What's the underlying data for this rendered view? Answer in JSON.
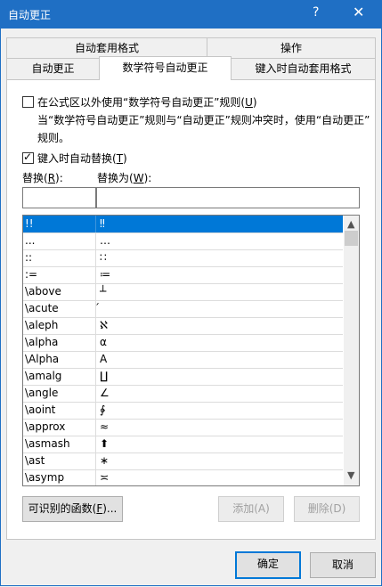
{
  "window": {
    "title": "自动更正",
    "help_glyph": "?",
    "close_glyph": "✕"
  },
  "tabs": {
    "row1": [
      "自动套用格式",
      "操作"
    ],
    "row2": [
      "自动更正",
      "数学符号自动更正",
      "键入时自动套用格式"
    ],
    "active": "数学符号自动更正"
  },
  "option_formula": {
    "checked": false,
    "label_pre": "在公式区以外使用“数学符号自动更正”规则(",
    "label_key": "U",
    "label_post": ")"
  },
  "note": {
    "line1": "当“数学符号自动更正”规则与“自动更正”规则冲突时，使用“自动更正”",
    "line2": "规则。"
  },
  "option_replace": {
    "checked": true,
    "check_glyph": "✓",
    "label_pre": "键入时自动替换(",
    "label_key": "T",
    "label_post": ")"
  },
  "fields": {
    "replace_label_pre": "替换(",
    "replace_label_key": "R",
    "replace_label_post": "):",
    "with_label_pre": "替换为(",
    "with_label_key": "W",
    "with_label_post": "):",
    "replace_value": "",
    "with_value": ""
  },
  "table": {
    "rows": [
      {
        "from": "!!",
        "to": "‼",
        "selected": true
      },
      {
        "from": "...",
        "to": "…"
      },
      {
        "from": "::",
        "to": "∷"
      },
      {
        "from": ":=",
        "to": "≔"
      },
      {
        "from": "\\above",
        "to": "┴"
      },
      {
        "from": "\\acute",
        "to": "́"
      },
      {
        "from": "\\aleph",
        "to": "ℵ"
      },
      {
        "from": "\\alpha",
        "to": "α"
      },
      {
        "from": "\\Alpha",
        "to": "A"
      },
      {
        "from": "\\amalg",
        "to": "∐"
      },
      {
        "from": "\\angle",
        "to": "∠"
      },
      {
        "from": "\\aoint",
        "to": "∳"
      },
      {
        "from": "\\approx",
        "to": "≈"
      },
      {
        "from": "\\asmash",
        "to": "⬆"
      },
      {
        "from": "\\ast",
        "to": "∗"
      },
      {
        "from": "\\asymp",
        "to": "≍"
      }
    ],
    "scroll_up_glyph": "▲",
    "scroll_down_glyph": "▼"
  },
  "buttons": {
    "functions_pre": "可识别的函数(",
    "functions_key": "F",
    "functions_post": ")...",
    "add": "添加(A)",
    "delete": "删除(D)",
    "ok": "确定",
    "cancel": "取消"
  },
  "colors": {
    "titlebar": "#1f6fc4",
    "selection": "#0078d7"
  }
}
